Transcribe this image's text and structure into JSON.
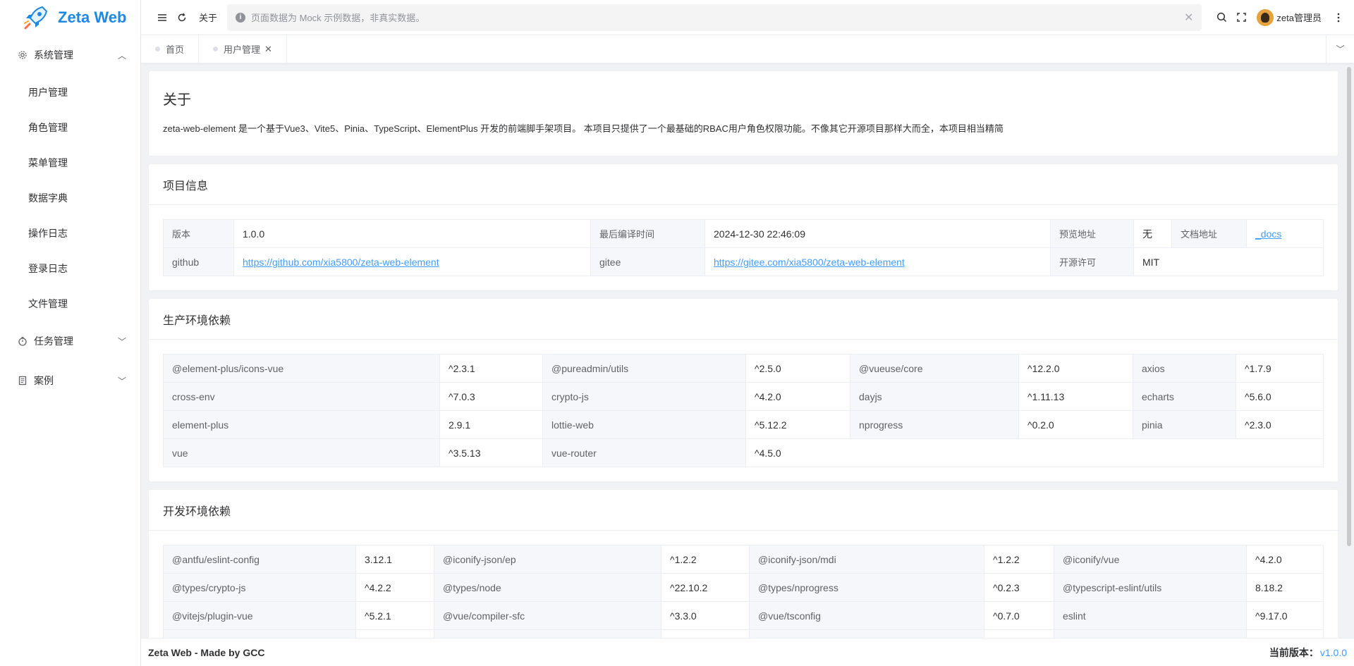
{
  "app": {
    "name": "Zeta Web",
    "brand_color": "#1e88e5",
    "accent_color": "#409eff"
  },
  "sidebar": {
    "groups": [
      {
        "label": "系统管理",
        "icon": "gear-icon",
        "expanded": true,
        "items": [
          "用户管理",
          "角色管理",
          "菜单管理",
          "数据字典",
          "操作日志",
          "登录日志",
          "文件管理"
        ]
      },
      {
        "label": "任务管理",
        "icon": "timer-icon",
        "expanded": false
      },
      {
        "label": "案例",
        "icon": "document-icon",
        "expanded": false
      }
    ]
  },
  "header": {
    "about": "关于",
    "notice": "页面数据为 Mock 示例数据，非真实数据。",
    "user": "zeta管理员"
  },
  "tabs": [
    {
      "label": "首页",
      "closable": false
    },
    {
      "label": "用户管理",
      "closable": true
    }
  ],
  "about": {
    "title": "关于",
    "description": "zeta-web-element 是一个基于Vue3、Vite5、Pinia、TypeScript、ElementPlus 开发的前端脚手架项目。 本项目只提供了一个最基础的RBAC用户角色权限功能。不像其它开源项目那样大而全，本项目相当精简"
  },
  "project_info": {
    "title": "项目信息",
    "version_label": "版本",
    "version": "1.0.0",
    "build_time_label": "最后编译时间",
    "build_time": "2024-12-30 22:46:09",
    "preview_label": "预览地址",
    "preview": "无",
    "docs_label": "文档地址",
    "docs": "_docs",
    "github_label": "github",
    "github": "https://github.com/xia5800/zeta-web-element",
    "gitee_label": "gitee",
    "gitee": "https://gitee.com/xia5800/zeta-web-element",
    "license_label": "开源许可",
    "license": "MIT"
  },
  "prod_deps": {
    "title": "生产环境依赖",
    "rows": [
      [
        [
          "@element-plus/icons-vue",
          "^2.3.1"
        ],
        [
          "@pureadmin/utils",
          "^2.5.0"
        ],
        [
          "@vueuse/core",
          "^12.2.0"
        ],
        [
          "axios",
          "^1.7.9"
        ]
      ],
      [
        [
          "cross-env",
          "^7.0.3"
        ],
        [
          "crypto-js",
          "^4.2.0"
        ],
        [
          "dayjs",
          "^1.11.13"
        ],
        [
          "echarts",
          "^5.6.0"
        ]
      ],
      [
        [
          "element-plus",
          "2.9.1"
        ],
        [
          "lottie-web",
          "^5.12.2"
        ],
        [
          "nprogress",
          "^0.2.0"
        ],
        [
          "pinia",
          "^2.3.0"
        ]
      ],
      [
        [
          "vue",
          "^3.5.13"
        ],
        [
          "vue-router",
          "^4.5.0"
        ]
      ]
    ]
  },
  "dev_deps": {
    "title": "开发环境依赖",
    "rows": [
      [
        [
          "@antfu/eslint-config",
          "3.12.1"
        ],
        [
          "@iconify-json/ep",
          "^1.2.2"
        ],
        [
          "@iconify-json/mdi",
          "^1.2.2"
        ],
        [
          "@iconify/vue",
          "^4.2.0"
        ]
      ],
      [
        [
          "@types/crypto-js",
          "^4.2.2"
        ],
        [
          "@types/node",
          "^22.10.2"
        ],
        [
          "@types/nprogress",
          "^0.2.3"
        ],
        [
          "@typescript-eslint/utils",
          "8.18.2"
        ]
      ],
      [
        [
          "@vitejs/plugin-vue",
          "^5.2.1"
        ],
        [
          "@vue/compiler-sfc",
          "^3.3.0"
        ],
        [
          "@vue/tsconfig",
          "^0.7.0"
        ],
        [
          "eslint",
          "^9.17.0"
        ]
      ],
      [
        [
          "",
          ""
        ],
        [
          "",
          ""
        ],
        [
          "",
          ""
        ],
        [
          "",
          ""
        ]
      ]
    ]
  },
  "footer": {
    "brand": "Zeta Web - Made by GCC",
    "version_label": "当前版本：",
    "version": "v1.0.0"
  }
}
